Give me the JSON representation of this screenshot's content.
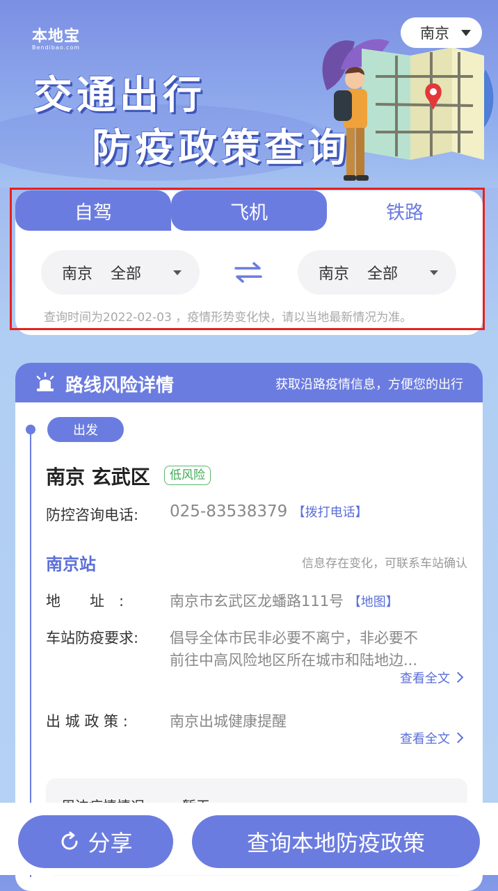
{
  "brand": {
    "logo_cn": "本地宝",
    "logo_en": "Bendibao.com"
  },
  "banner": {
    "title_line1": "交通出行",
    "title_line2": "防疫政策查询"
  },
  "city_selector": {
    "value": "南京"
  },
  "mode_tabs": [
    {
      "label": "自驾"
    },
    {
      "label": "飞机"
    },
    {
      "label": "铁路"
    }
  ],
  "active_tab": "铁路",
  "from_select": {
    "city": "南京",
    "district": "全部"
  },
  "to_select": {
    "city": "南京",
    "district": "全部"
  },
  "query_notice": "查询时间为2022-02-03 ，疫情形势变化快，请以当地最新情况为准。",
  "route": {
    "title": "路线风险详情",
    "subtitle": "获取沿路疫情信息，方便您的出行",
    "depart_label": "出发",
    "place": "南京 玄武区",
    "risk": "低风险",
    "hotline_label": "防控咨询电话:",
    "hotline_value": "025-83538379",
    "call_link": "【拨打电话】",
    "station_name": "南京站",
    "station_note": "信息存在变化，可联系车站确认",
    "address_label": "地　　址　:",
    "address_value": "南京市玄武区龙蟠路111号",
    "map_link": "【地图】",
    "requirement_label": "车站防疫要求:",
    "requirement_line1": "倡导全体市民非必要不离宁，非必要不",
    "requirement_line2": "前往中高风险地区所在城市和陆地边...",
    "more_link_1": "查看全文",
    "exit_policy_label": "出 城 政 策 :",
    "exit_policy_value": "南京出城健康提醒",
    "more_link_2": "查看全文",
    "nearby_label": "周边疫情情况",
    "nearby_value": "暂无"
  },
  "bottom": {
    "share_label": "分享",
    "query_label": "查询本地防疫政策"
  },
  "colors": {
    "accent": "#6b7ce0",
    "highlight_frame": "#e8201c",
    "risk_low": "#3fa853"
  }
}
